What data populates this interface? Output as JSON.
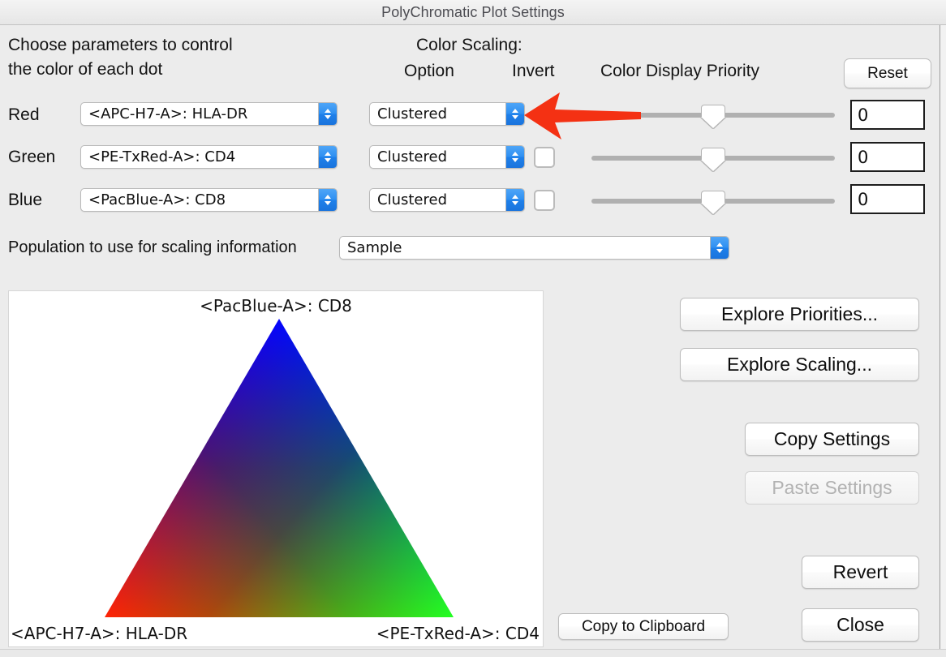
{
  "window": {
    "title": "PolyChromatic Plot Settings"
  },
  "header": {
    "instructions": "Choose parameters to control\nthe color of each dot",
    "color_scaling_label": "Color Scaling:",
    "option_label": "Option",
    "invert_label": "Invert",
    "priority_label": "Color Display Priority",
    "reset_label": "Reset"
  },
  "rows": [
    {
      "channel_label": "Red",
      "parameter": "<APC-H7-A>: HLA-DR",
      "scaling_option": "Clustered",
      "invert_checked": false,
      "priority_value": "0",
      "slider_position": 0.5
    },
    {
      "channel_label": "Green",
      "parameter": "<PE-TxRed-A>: CD4",
      "scaling_option": "Clustered",
      "invert_checked": false,
      "priority_value": "0",
      "slider_position": 0.5
    },
    {
      "channel_label": "Blue",
      "parameter": "<PacBlue-A>: CD8",
      "scaling_option": "Clustered",
      "invert_checked": false,
      "priority_value": "0",
      "slider_position": 0.5
    }
  ],
  "population": {
    "label": "Population to use for scaling information",
    "value": "Sample"
  },
  "plot": {
    "apex_label": "<PacBlue-A>: CD8",
    "bottom_left_label": "<APC-H7-A>: HLA-DR",
    "bottom_right_label": "<PE-TxRed-A>: CD4",
    "apex_color": "#0000ee",
    "bottom_left_color": "#ee0000",
    "bottom_right_color": "#00dd22",
    "background": "#ffffff"
  },
  "buttons": {
    "explore_priorities": "Explore Priorities...",
    "explore_scaling": "Explore Scaling...",
    "copy_settings": "Copy Settings",
    "paste_settings": "Paste Settings",
    "paste_settings_enabled": false,
    "revert": "Revert",
    "close": "Close",
    "copy_to_clipboard": "Copy to Clipboard"
  },
  "annotation": {
    "arrow_color": "#f43113",
    "arrow_direction": "left",
    "points_at": "red-scaling-option-popup"
  }
}
